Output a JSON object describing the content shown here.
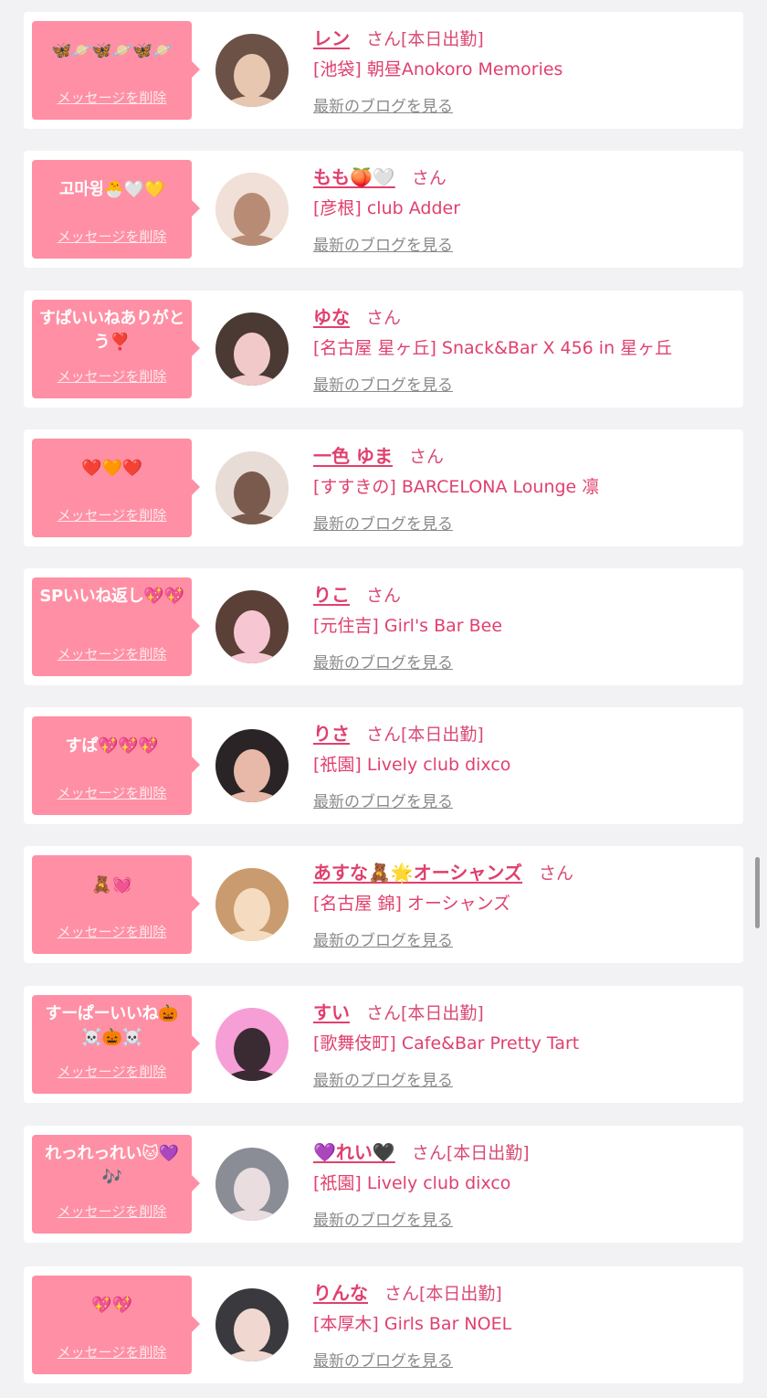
{
  "delete_label": "メッセージを削除",
  "blog_label": "最新のブログを見る",
  "colors": {
    "bubble": "#ff8fa4",
    "name": "#e0406e",
    "link_gray": "#8a8a8a",
    "page_bg": "#f2f2f4"
  },
  "entries": [
    {
      "message": "🦋🪐🦋🪐🦋🪐",
      "name": "レン",
      "san": "さん",
      "today": "[本日出勤]",
      "shop": "[池袋] 朝昼Anokoro Memories",
      "avatar_bg": "#6b5146",
      "avatar_fg": "#e8c7b1"
    },
    {
      "message": "고마윙🐣🤍💛",
      "name": "もも🍑🤍",
      "san": "さん",
      "today": "",
      "shop": "[彦根] club Adder",
      "avatar_bg": "#f0e0d8",
      "avatar_fg": "#b88c74"
    },
    {
      "message": "すぱいいねありがとう❣️",
      "name": "ゆな",
      "san": "さん",
      "today": "",
      "shop": "[名古屋 星ヶ丘] Snack&Bar X 456 in 星ヶ丘",
      "avatar_bg": "#4a3a33",
      "avatar_fg": "#f2c9c9"
    },
    {
      "message": "❤️🧡❤️",
      "name": "一色 ゆま",
      "san": "さん",
      "today": "",
      "shop": "[すすきの] BARCELONA Lounge 凛",
      "avatar_bg": "#e8dcd6",
      "avatar_fg": "#7a5a4c"
    },
    {
      "message": "SPいいね返し💖💖",
      "name": "りこ",
      "san": "さん",
      "today": "",
      "shop": "[元住吉] Girl's Bar Bee",
      "avatar_bg": "#5a4036",
      "avatar_fg": "#f6c7d2"
    },
    {
      "message": "すぱ💖💖💖",
      "name": "りさ",
      "san": "さん",
      "today": "[本日出勤]",
      "shop": "[祇園] Lively club dixco",
      "avatar_bg": "#2a2426",
      "avatar_fg": "#e8b9a8"
    },
    {
      "message": "🧸💓",
      "name": "あすな🧸🌟オーシャンズ",
      "san": "さん",
      "today": "",
      "shop": "[名古屋 錦] オーシャンズ",
      "avatar_bg": "#c99b6e",
      "avatar_fg": "#f5dcc0"
    },
    {
      "message": "すーぱーいいね🎃☠️🎃☠️",
      "name": "すい",
      "san": "さん",
      "today": "[本日出勤]",
      "shop": "[歌舞伎町] Cafe&Bar Pretty Tart",
      "avatar_bg": "#f59fd6",
      "avatar_fg": "#3a2a32"
    },
    {
      "message": "れっれっれい🐱💜🎶",
      "name": "💜れい🖤",
      "san": "さん",
      "today": "[本日出勤]",
      "shop": "[祇園] Lively club dixco",
      "avatar_bg": "#8a8c96",
      "avatar_fg": "#e9dde0"
    },
    {
      "message": "💖💖",
      "name": "りんな",
      "san": "さん",
      "today": "[本日出勤]",
      "shop": "[本厚木] Girls Bar NOEL",
      "avatar_bg": "#3a3a3e",
      "avatar_fg": "#f0d8d0"
    }
  ]
}
